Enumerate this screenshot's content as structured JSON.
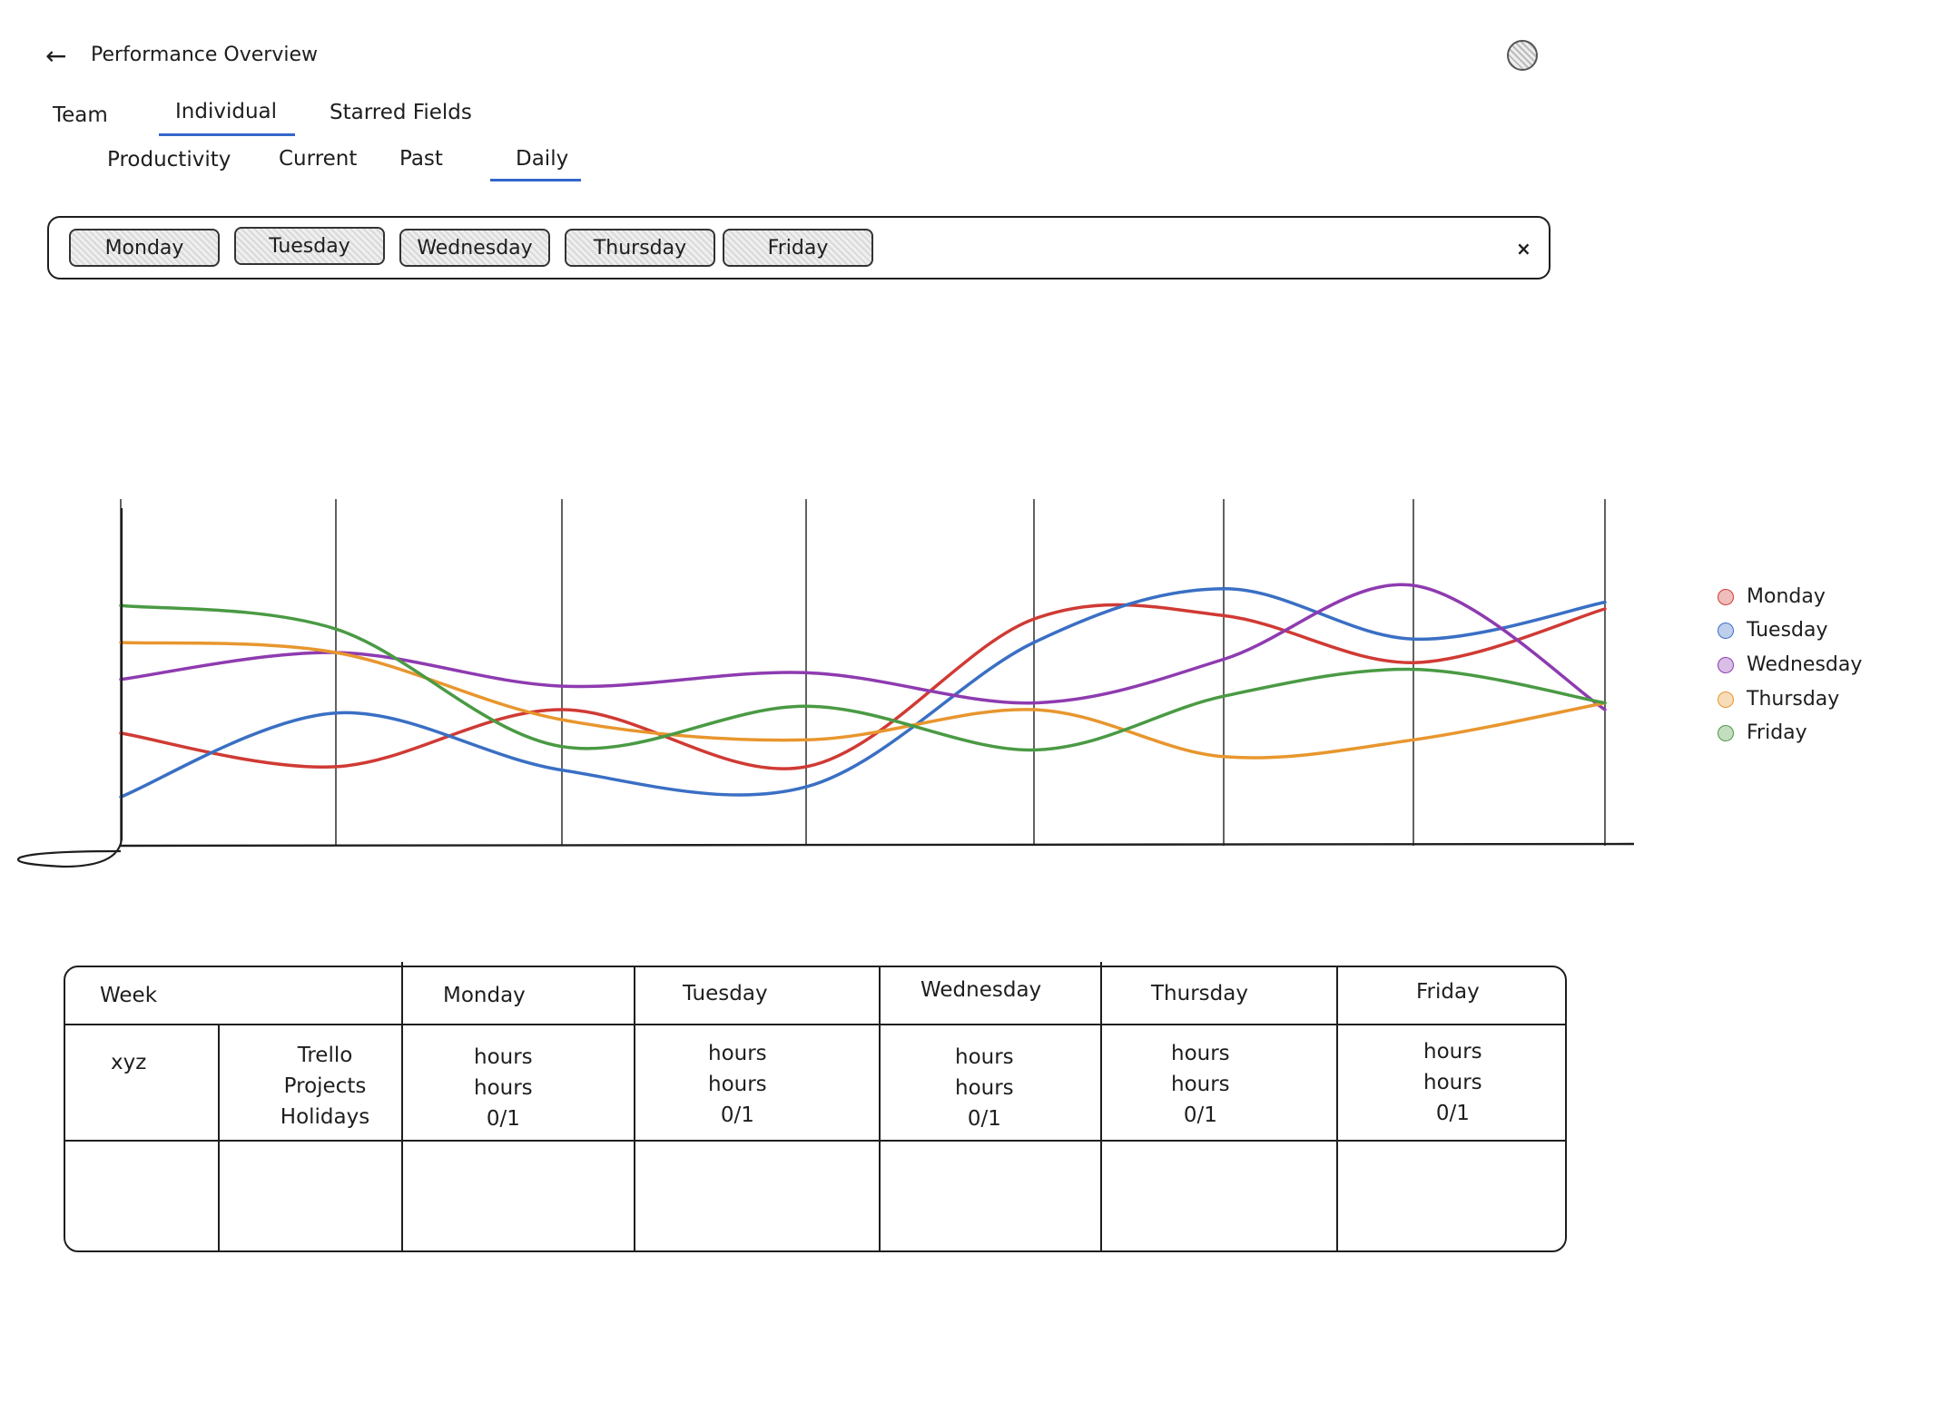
{
  "header": {
    "back_icon": "arrow-left-icon",
    "title": "Performance Overview",
    "avatar_icon": "user-avatar-icon"
  },
  "tabs": [
    {
      "label": "Team",
      "active": false
    },
    {
      "label": "Individual",
      "active": true
    },
    {
      "label": "Starred Fields",
      "active": false
    }
  ],
  "subtabs": [
    {
      "label": "Productivity",
      "active": false
    },
    {
      "label": "Current",
      "active": false
    },
    {
      "label": "Past",
      "active": false
    },
    {
      "label": "Daily",
      "active": true
    }
  ],
  "filter": {
    "chips": [
      "Monday",
      "Tuesday",
      "Wednesday",
      "Thursday",
      "Friday"
    ],
    "clear_label": "×"
  },
  "colors": {
    "accent": "#3366cc",
    "Monday": "#d03a34",
    "Tuesday": "#3a6fc4",
    "Wednesday": "#8e3bb0",
    "Thursday": "#e8962e",
    "Friday": "#4a9a44"
  },
  "chart_data": {
    "type": "line",
    "x": [
      0,
      1,
      2,
      3,
      4,
      5,
      6,
      7
    ],
    "ylim": [
      0,
      100
    ],
    "grid": true,
    "legend_position": "right",
    "series": [
      {
        "name": "Monday",
        "values": [
          33,
          23,
          40,
          23,
          67,
          68,
          54,
          70
        ]
      },
      {
        "name": "Tuesday",
        "values": [
          14,
          39,
          22,
          17,
          60,
          76,
          61,
          72
        ]
      },
      {
        "name": "Wednesday",
        "values": [
          49,
          57,
          47,
          51,
          42,
          55,
          77,
          40
        ]
      },
      {
        "name": "Thursday",
        "values": [
          60,
          57,
          37,
          31,
          40,
          26,
          31,
          42
        ]
      },
      {
        "name": "Friday",
        "values": [
          71,
          64,
          29,
          41,
          28,
          44,
          52,
          42
        ]
      }
    ]
  },
  "table": {
    "headers": [
      "Week",
      "Monday",
      "Tuesday",
      "Wednesday",
      "Thursday",
      "Friday"
    ],
    "row_label": "xyz",
    "row_fields": [
      "Trello",
      "Projects",
      "Holidays"
    ],
    "days": [
      [
        "hours",
        "hours",
        "0/1"
      ],
      [
        "hours",
        "hours",
        "0/1"
      ],
      [
        "hours",
        "hours",
        "0/1"
      ],
      [
        "hours",
        "hours",
        "0/1"
      ],
      [
        "hours",
        "hours",
        "0/1"
      ]
    ]
  }
}
